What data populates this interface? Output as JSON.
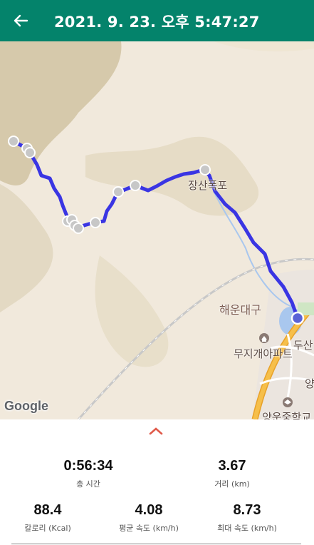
{
  "header": {
    "title": "2021. 9. 23. 오후 5:47:27",
    "back_icon": "arrow-left-icon",
    "background_color": "#04836b"
  },
  "map": {
    "labels": {
      "jangsan": "장산폭포",
      "haeundae": "해운대구",
      "dusan": "두산",
      "muji": "무지개아파트",
      "yang": "양운중학교",
      "yang_edge": "양"
    },
    "logo": "Google",
    "route_color": "#3a35e3",
    "marker_color": "#c7c7c7",
    "current_location_color": "#5a63d6"
  },
  "stats": {
    "toggle_icon": "chevron-up-icon",
    "toggle_color": "#e05a4a",
    "total_time": {
      "value": "0:56:34",
      "label": "총 시간"
    },
    "distance": {
      "value": "3.67",
      "label": "거리 (km)"
    },
    "calories": {
      "value": "88.4",
      "label": "칼로리 (Kcal)"
    },
    "avg_speed": {
      "value": "4.08",
      "label": "평균 속도 (km/h)"
    },
    "max_speed": {
      "value": "8.73",
      "label": "최대 속도 (km/h)"
    }
  }
}
